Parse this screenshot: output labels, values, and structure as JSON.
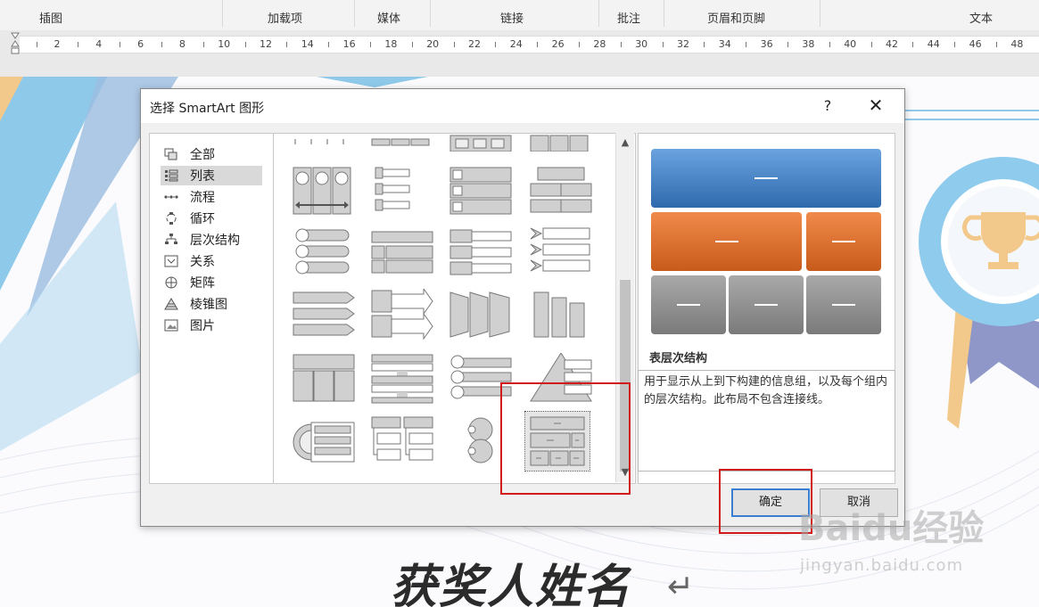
{
  "ribbon": {
    "groups": [
      "插图",
      "加载项",
      "媒体",
      "链接",
      "批注",
      "页眉和页脚",
      "文本"
    ]
  },
  "ruler": {
    "numbers": [
      "2",
      "4",
      "6",
      "8",
      "10",
      "12",
      "14",
      "16",
      "18",
      "20",
      "22",
      "24",
      "26",
      "28",
      "30",
      "32",
      "34",
      "36",
      "38",
      "40",
      "42",
      "44",
      "46",
      "48"
    ]
  },
  "document": {
    "title": "获奖人姓名",
    "return_mark": "↵"
  },
  "dialog": {
    "title": "选择 SmartArt 图形",
    "help": "?",
    "close": "✕",
    "categories": [
      {
        "label": "全部",
        "icon": "all-icon"
      },
      {
        "label": "列表",
        "icon": "list-icon"
      },
      {
        "label": "流程",
        "icon": "process-icon"
      },
      {
        "label": "循环",
        "icon": "cycle-icon"
      },
      {
        "label": "层次结构",
        "icon": "hierarchy-icon"
      },
      {
        "label": "关系",
        "icon": "relationship-icon"
      },
      {
        "label": "矩阵",
        "icon": "matrix-icon"
      },
      {
        "label": "棱锥图",
        "icon": "pyramid-icon"
      },
      {
        "label": "图片",
        "icon": "picture-icon"
      }
    ],
    "selected_category": "列表",
    "preview": {
      "name": "表层次结构",
      "description": "用于显示从上到下构建的信息组，以及每个组内的层次结构。此布局不包含连接线。",
      "colors": {
        "top": "#3e7cc2",
        "middle": "#de6a26",
        "bottom": "#8c8c8c"
      }
    },
    "buttons": {
      "ok": "确定",
      "cancel": "取消"
    }
  },
  "watermark": {
    "main": "Baidu经验",
    "sub": "jingyan.baidu.com"
  },
  "colors": {
    "highlight": "#d11a1a",
    "focus": "#3c7fd0"
  }
}
